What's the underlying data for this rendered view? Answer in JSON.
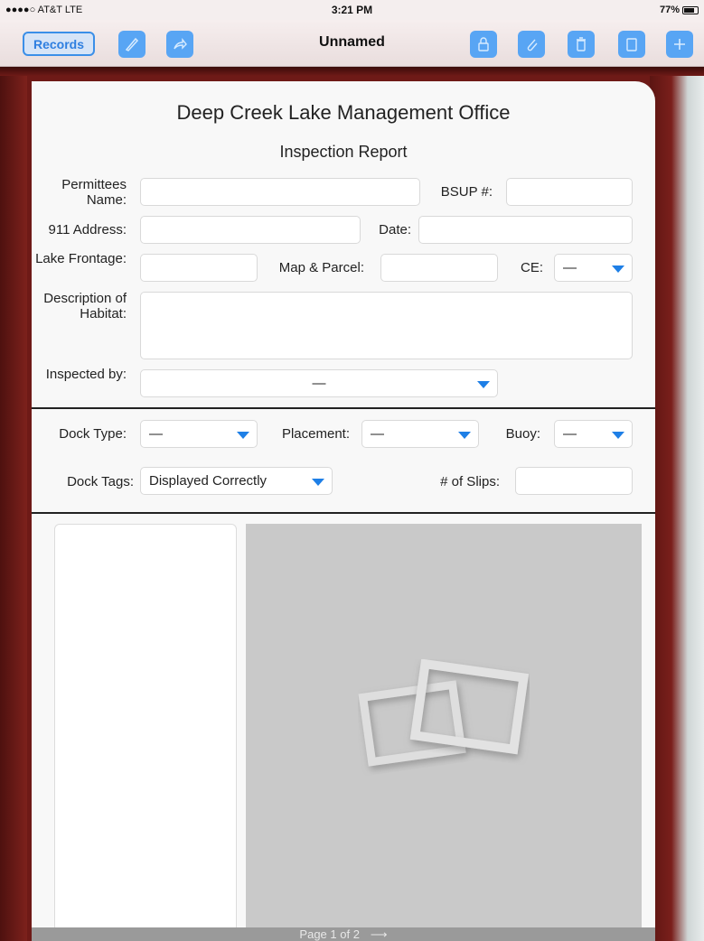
{
  "status": {
    "carrier": "●●●●○ AT&T  LTE",
    "time": "3:21 PM",
    "battery": "77%"
  },
  "nav": {
    "records_label": "Records",
    "title": "Unnamed",
    "left_icons": [
      "pen-icon",
      "share-icon"
    ],
    "right_icons": [
      "lock-icon",
      "attach-icon",
      "trash-icon",
      "duplicate-icon",
      "add-icon"
    ],
    "accent": "#3b8fe8"
  },
  "form": {
    "heading": "Deep Creek Lake Management Office",
    "subheading": "Inspection Report",
    "permittees_label": "Permittees Name:",
    "bsup_label": "BSUP #:",
    "address_label": "911 Address:",
    "date_label": "Date:",
    "frontage_label": "Lake Frontage:",
    "map_parcel_label": "Map & Parcel:",
    "ce_label": "CE:",
    "ce_value": "—",
    "habitat_label": "Description of Habitat:",
    "inspected_label": "Inspected by:",
    "inspected_value": "—",
    "dock_type_label": "Dock Type:",
    "dock_type_value": "—",
    "placement_label": "Placement:",
    "placement_value": "—",
    "buoy_label": "Buoy:",
    "buoy_value": "—",
    "dock_tags_label": "Dock Tags:",
    "dock_tags_value": "Displayed Correctly",
    "slips_label": "# of Slips:"
  },
  "footer": {
    "page_label": "Page 1 of 2",
    "arrow": "⟶"
  }
}
